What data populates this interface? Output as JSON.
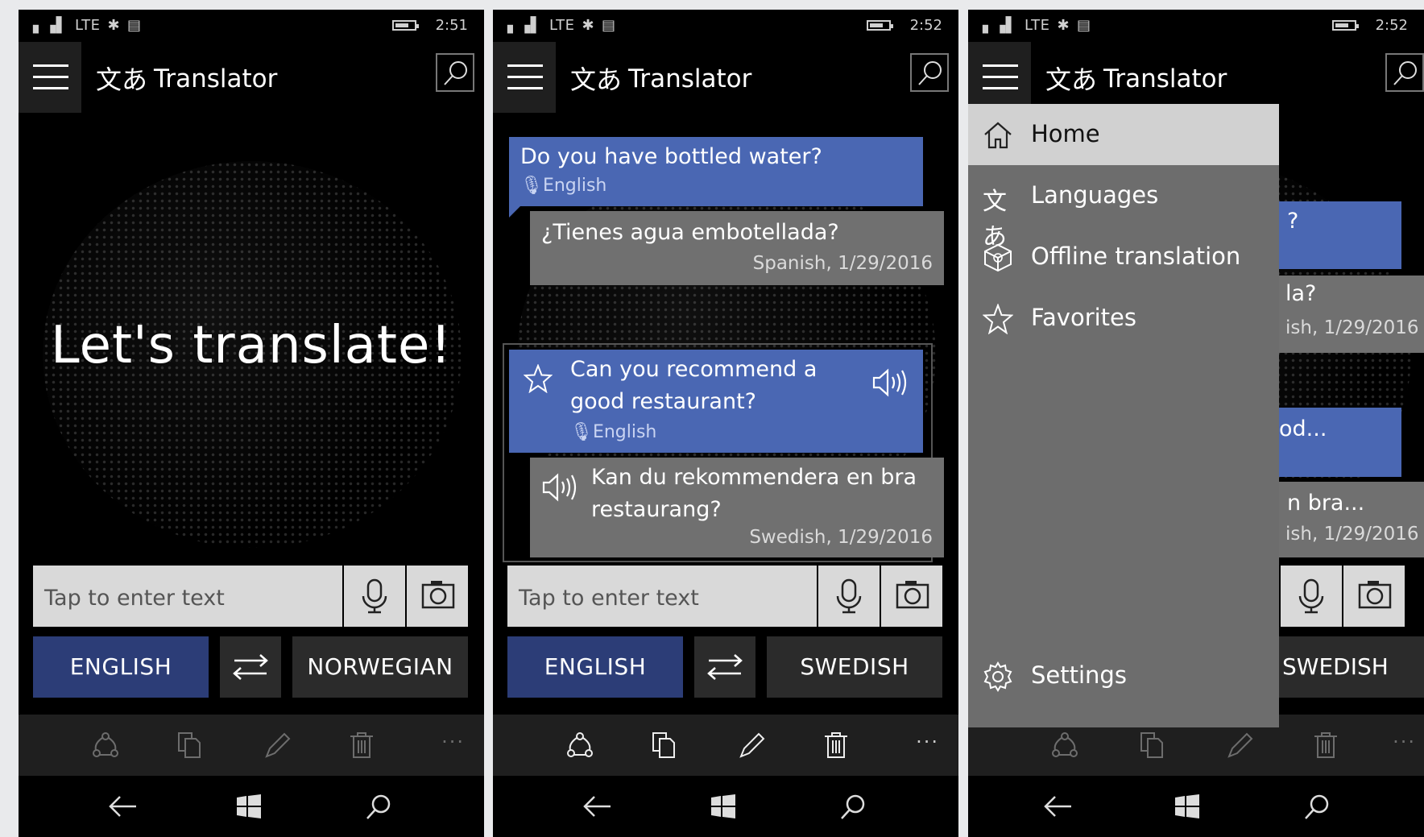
{
  "screens": [
    {
      "status": {
        "signal": "LTE",
        "time": "2:51"
      },
      "header": {
        "app_icon_glyph": "文あ",
        "title": "Translator"
      },
      "hero_text": "Let's translate!",
      "input": {
        "placeholder": "Tap to enter text"
      },
      "languages": {
        "from": "ENGLISH",
        "to": "NORWEGIAN"
      }
    },
    {
      "status": {
        "signal": "LTE",
        "time": "2:52"
      },
      "header": {
        "app_icon_glyph": "文あ",
        "title": "Translator"
      },
      "conversation": [
        {
          "text": "Do you have bottled water?",
          "source": "English"
        },
        {
          "text": "¿Tienes agua embotellada?",
          "meta": "Spanish, 1/29/2016"
        },
        {
          "text_line1": "Can you recommend a",
          "text_line2": "good restaurant?",
          "source": "English"
        },
        {
          "text_line1": "Kan du rekommendera en bra",
          "text_line2": "restaurang?",
          "meta": "Swedish, 1/29/2016"
        }
      ],
      "input": {
        "placeholder": "Tap to enter text"
      },
      "languages": {
        "from": "ENGLISH",
        "to": "SWEDISH"
      }
    },
    {
      "status": {
        "signal": "LTE",
        "time": "2:52"
      },
      "header": {
        "app_icon_glyph": "文あ",
        "title": "Translator"
      },
      "menu": {
        "items": [
          {
            "label": "Home",
            "icon": "home-icon",
            "active": true
          },
          {
            "label": "Languages",
            "icon": "languages-icon"
          },
          {
            "label": "Offline translation",
            "icon": "offline-package-icon"
          },
          {
            "label": "Favorites",
            "icon": "star-icon"
          }
        ],
        "settings_label": "Settings"
      },
      "peek": {
        "b1": "?",
        "b2": "la?",
        "b2_meta": "ish, 1/29/2016",
        "b3": "od...",
        "b4": "n bra...",
        "b4_meta": "ish, 1/29/2016",
        "lang_to": "SWEDISH"
      }
    }
  ],
  "colors": {
    "accent_blue": "#4a67b3",
    "lang_button_blue": "#2c3d77",
    "bubble_grey": "#707070",
    "menu_grey": "#6d6d6d"
  }
}
